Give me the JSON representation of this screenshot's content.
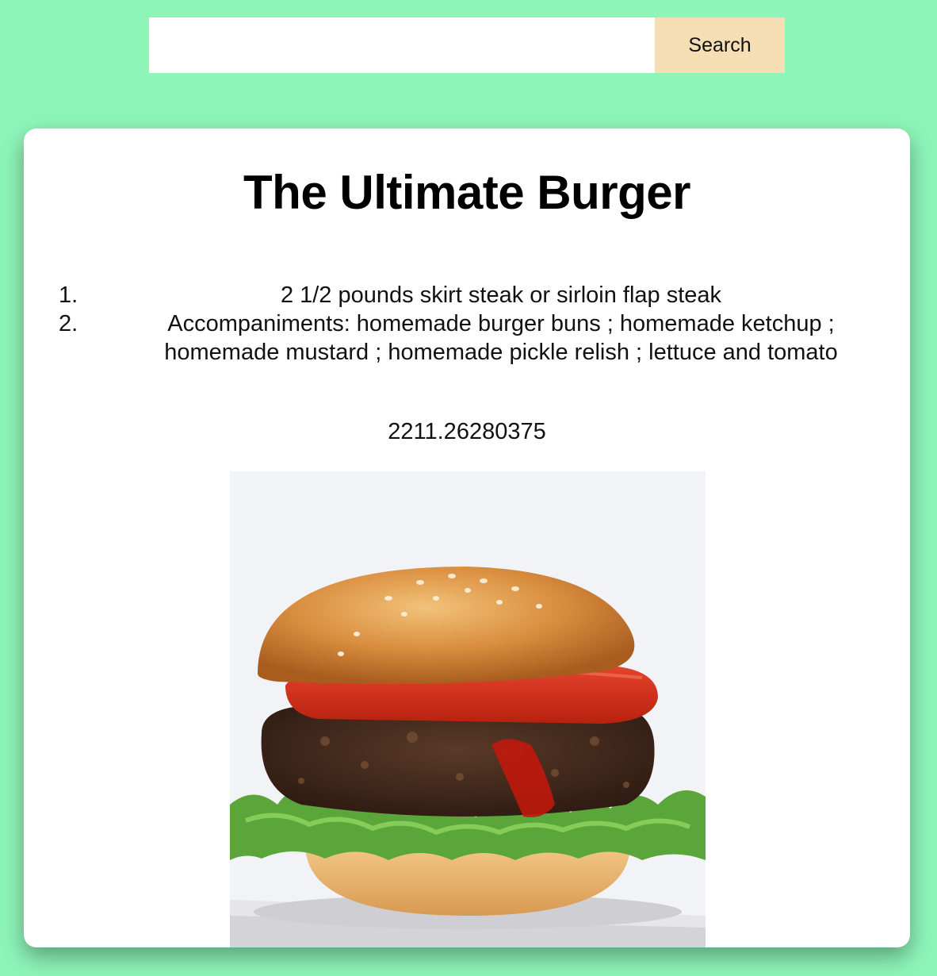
{
  "search": {
    "value": "",
    "placeholder": "",
    "button_label": "Search"
  },
  "recipe": {
    "title": "The Ultimate Burger",
    "ingredients": [
      {
        "num": "1.",
        "text": "2 1/2 pounds skirt steak or sirloin flap steak"
      },
      {
        "num": "2.",
        "text": "Accompaniments: homemade burger buns ; homemade ketchup ; homemade mustard ; homemade pickle relish ; lettuce and tomato"
      }
    ],
    "value": "2211.26280375"
  },
  "colors": {
    "background": "#8ef5b9",
    "search_button": "#f5deb3",
    "card": "#ffffff"
  }
}
